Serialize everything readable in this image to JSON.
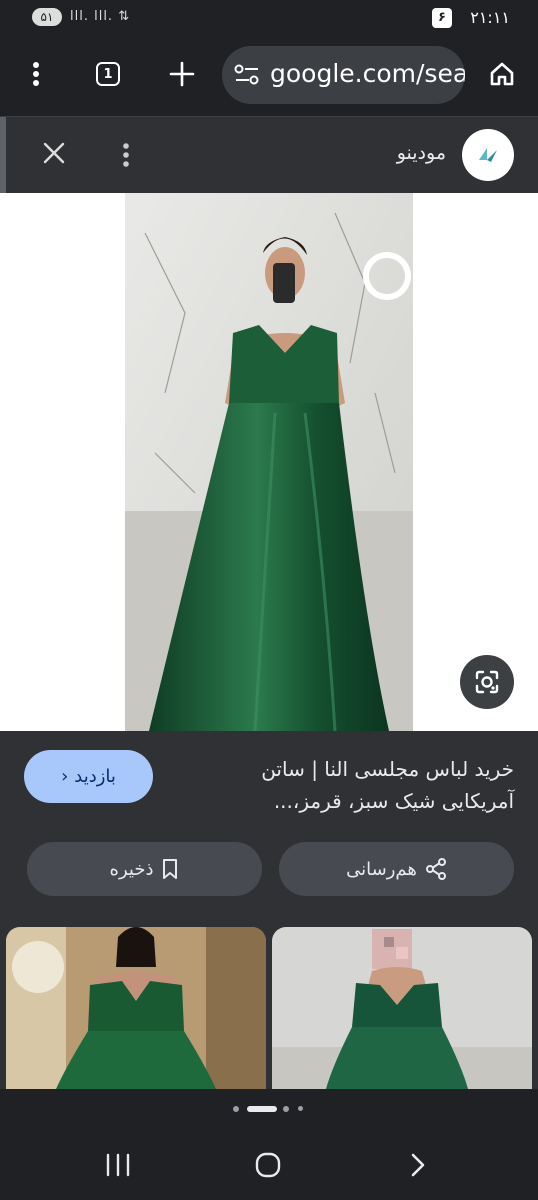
{
  "status_bar": {
    "time": "۲۱:۱۱",
    "notification_badge": "۶",
    "battery": "۵۱",
    "signal": "lll. lll. ⇅"
  },
  "browser": {
    "url": "google.com/sea",
    "tab_count": "1"
  },
  "sheet": {
    "site_name": "مودینو",
    "title": "خرید لباس مجلسی النا | ساتن آمریکایی شیک سبز، قرمز،...",
    "visit_label": "بازدید",
    "visit_chevron": "‹",
    "share_label": "هم‌رسانی",
    "save_label": "ذخیره"
  },
  "colors": {
    "background": "#1f2125",
    "sheet": "#303134",
    "visit_button": "#a8c7fa",
    "dress_green": "#1f5a38"
  },
  "icons": [
    "menu-dots-icon",
    "tabs-icon",
    "plus-icon",
    "tune-icon",
    "home-icon",
    "close-icon",
    "more-vert-icon",
    "site-logo-icon",
    "google-lens-icon",
    "chevron-left-icon",
    "share-icon",
    "bookmark-icon",
    "recents-icon",
    "home-circle-icon",
    "back-icon"
  ]
}
